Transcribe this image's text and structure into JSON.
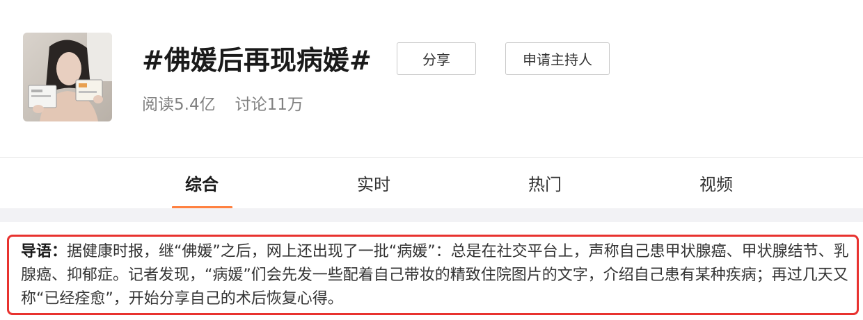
{
  "topic": {
    "title": "#佛媛后再现病媛#",
    "share_label": "分享",
    "apply_host_label": "申请主持人",
    "reads": "阅读5.4亿",
    "discussions": "讨论11万"
  },
  "tabs": [
    {
      "label": "综合",
      "active": true
    },
    {
      "label": "实时",
      "active": false
    },
    {
      "label": "热门",
      "active": false
    },
    {
      "label": "视频",
      "active": false
    }
  ],
  "intro": {
    "label": "导语：",
    "text": "据健康时报，继“佛媛”之后，网上还出现了一批“病媛”：总是在社交平台上，声称自己患甲状腺癌、甲状腺结节、乳腺癌、抑郁症。记者发现，“病媛”们会先发一些配着自己带妆的精致住院图片的文字，介绍自己患有某种疾病；再过几天又称“已经痊愈”，开始分享自己的术后恢复心得。"
  },
  "colors": {
    "accent_tab": "#ff8140",
    "highlight_border": "#e8322f",
    "title_text": "#1a1a1a",
    "muted_text": "#808080"
  }
}
